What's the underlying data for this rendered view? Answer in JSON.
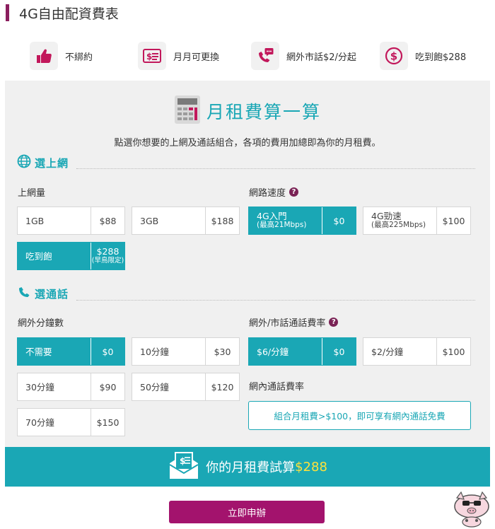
{
  "header": {
    "title": "4G自由配資費表"
  },
  "features": [
    {
      "label": "不綁約",
      "icon": "thumbs-up-icon"
    },
    {
      "label": "月月可更換",
      "icon": "dollar-card-icon"
    },
    {
      "label": "網外市話$2/分起",
      "icon": "phone-chat-icon"
    },
    {
      "label": "吃到飽$288",
      "icon": "dollar-circle-icon"
    }
  ],
  "calc": {
    "title": "月租費算一算",
    "description": "點選你想要的上網及通話組合，各項的費用加總即為你的月租費。"
  },
  "internet": {
    "heading": "選上網",
    "data_label": "上網量",
    "data_options": [
      {
        "name": "1GB",
        "price": "$88",
        "selected": false
      },
      {
        "name": "3GB",
        "price": "$188",
        "selected": false
      },
      {
        "name": "吃到飽",
        "price": "$288",
        "price_note": "(早鳥限定)",
        "selected": true
      }
    ],
    "speed_label": "網路速度",
    "speed_options": [
      {
        "name": "4G入門",
        "note": "(最高21Mbps)",
        "price": "$0",
        "selected": true
      },
      {
        "name": "4G勁速",
        "note": "(最高225Mbps)",
        "price": "$100",
        "selected": false
      }
    ]
  },
  "calls": {
    "heading": "選通話",
    "minutes_label": "網外分鐘數",
    "minutes_options": [
      {
        "name": "不需要",
        "price": "$0",
        "selected": true
      },
      {
        "name": "10分鐘",
        "price": "$30",
        "selected": false
      },
      {
        "name": "30分鐘",
        "price": "$90",
        "selected": false
      },
      {
        "name": "50分鐘",
        "price": "$120",
        "selected": false
      },
      {
        "name": "70分鐘",
        "price": "$150",
        "selected": false
      }
    ],
    "rate_label": "網外/市話通話費率",
    "rate_options": [
      {
        "name": "$6/分鐘",
        "price": "$0",
        "selected": true
      },
      {
        "name": "$2/分鐘",
        "price": "$100",
        "selected": false
      }
    ],
    "onnet_label": "網內通話費率",
    "onnet_free_text": "組合月租費>$100，即可享有網內通話免費"
  },
  "total": {
    "text": "你的月租費試算",
    "amount": "$288"
  },
  "apply": {
    "label": "立即申辦"
  },
  "colors": {
    "accent": "#1aa7b5",
    "brand": "#a3136d",
    "header_bar": "#8b1e5e",
    "highlight": "#ffe23b"
  }
}
